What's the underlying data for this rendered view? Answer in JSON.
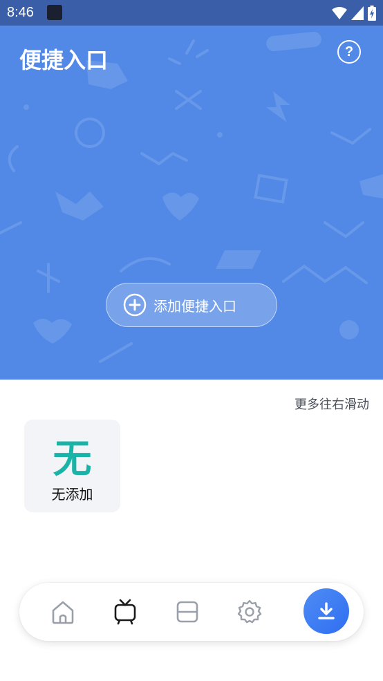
{
  "status_bar": {
    "time": "8:46"
  },
  "header": {
    "title": "便捷入口",
    "help_label": "?",
    "add_button_label": "添加便捷入口"
  },
  "content": {
    "scroll_hint": "更多往右滑动",
    "shortcut": {
      "glyph": "无",
      "label": "无添加"
    }
  },
  "bottom_nav": {
    "items": [
      "home-icon",
      "tv-icon",
      "cards-icon",
      "settings-icon",
      "download-icon"
    ]
  },
  "colors": {
    "header_bg": "#5289e6",
    "accent_teal": "#19b3a8",
    "download_button": "#3a78f2"
  }
}
